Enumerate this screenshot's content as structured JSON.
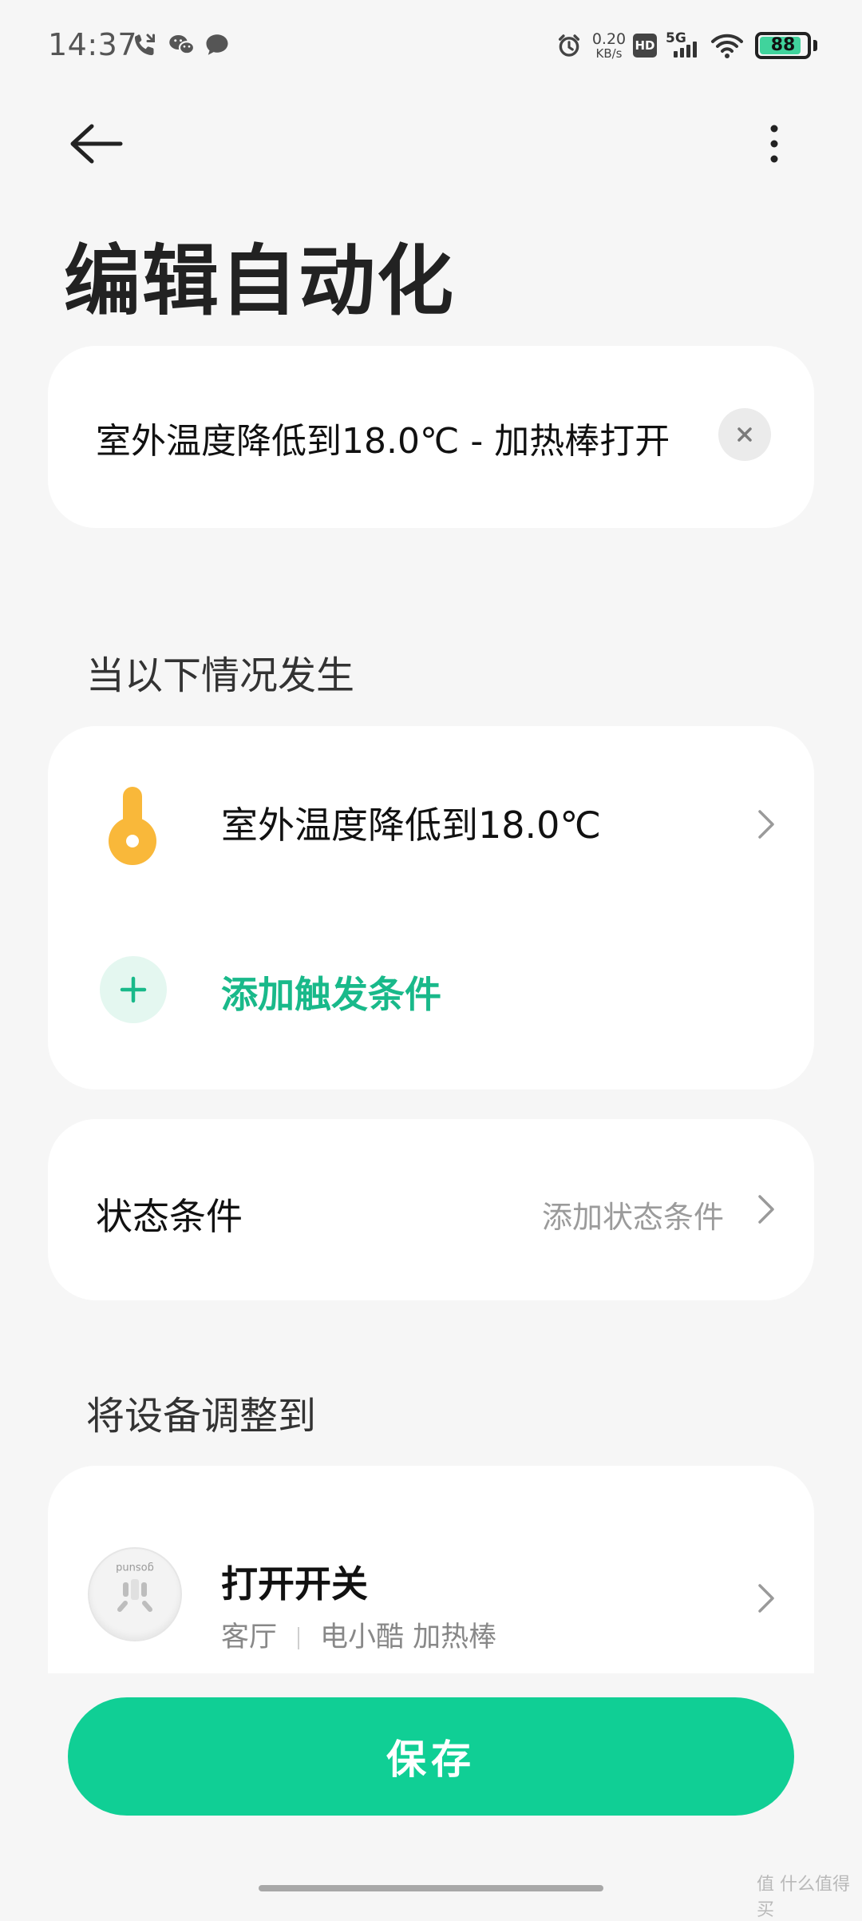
{
  "status_bar": {
    "time": "14:37",
    "net_speed_value": "0.20",
    "net_speed_unit": "KB/s",
    "hd_label": "HD",
    "network_label": "5G",
    "battery_level": 88,
    "battery_text": "88",
    "battery_color": "#40d39c",
    "icons": [
      "missed-call-icon",
      "wechat-icon",
      "message-icon",
      "alarm-icon",
      "signal-icon",
      "wifi-icon"
    ]
  },
  "header": {
    "back_icon": "arrow-left-icon",
    "more_icon": "more-vertical-icon",
    "title": "编辑自动化"
  },
  "name_field": {
    "value": "室外温度降低到18.0℃ - 加热棒打开",
    "clear_icon": "close-icon"
  },
  "trigger_section": {
    "title": "当以下情况发生",
    "trigger": {
      "icon": "thermometer-icon",
      "icon_color": "#f9b83a",
      "label": "室外温度降低到18.0℃"
    },
    "add": {
      "icon": "plus-icon",
      "label": "添加触发条件",
      "color": "#19b98a"
    }
  },
  "state_section": {
    "label": "状态条件",
    "hint": "添加状态条件"
  },
  "action_section": {
    "title": "将设备调整到",
    "action": {
      "icon": "smart-plug-icon",
      "device_brand": "gosund",
      "title": "打开开关",
      "room": "客厅",
      "device": "电小酷 加热棒"
    }
  },
  "save_button": {
    "label": "保存",
    "color": "#10cf95"
  },
  "watermark": "值 什么值得买"
}
